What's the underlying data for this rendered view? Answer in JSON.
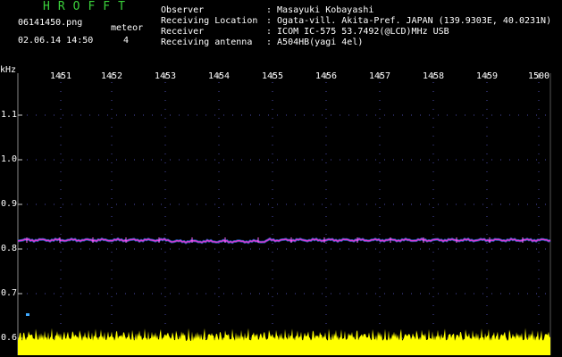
{
  "app": {
    "title": "HROFFT",
    "file": "06141450.png",
    "datetime": "02.06.14 14:50"
  },
  "meteor": {
    "label": "meteor",
    "count": "4"
  },
  "station": [
    {
      "key": "Observer",
      "value": ": Masayuki Kobayashi"
    },
    {
      "key": "Receiving Location",
      "value": ": Ogata-vill. Akita-Pref. JAPAN (139.9303E, 40.0231N)"
    },
    {
      "key": "Receiver",
      "value": ": ICOM IC-575 53.7492(@LCD)MHz USB"
    },
    {
      "key": "Receiving antenna",
      "value": ": A504HB(yagi 4el)"
    }
  ],
  "y_unit": "kHz",
  "x_ticks": [
    "1451",
    "1452",
    "1453",
    "1454",
    "1455",
    "1456",
    "1457",
    "1458",
    "1459",
    "1500"
  ],
  "y_ticks": [
    "1.1",
    "1.0",
    "0.9",
    "0.8",
    "0.7",
    "0.6"
  ],
  "colors": {
    "title": "#3bd23b",
    "grid": "#4a4aa8",
    "trace": "#d43cd4",
    "noise": "#ffff00",
    "bg": "#000000"
  },
  "chart_data": {
    "type": "heatmap",
    "x": [
      "1451",
      "1452",
      "1453",
      "1454",
      "1455",
      "1456",
      "1457",
      "1458",
      "1459",
      "1500"
    ],
    "ylabel": "kHz",
    "ylim": [
      0.6,
      1.1
    ],
    "carrier_khz": 0.82
  }
}
